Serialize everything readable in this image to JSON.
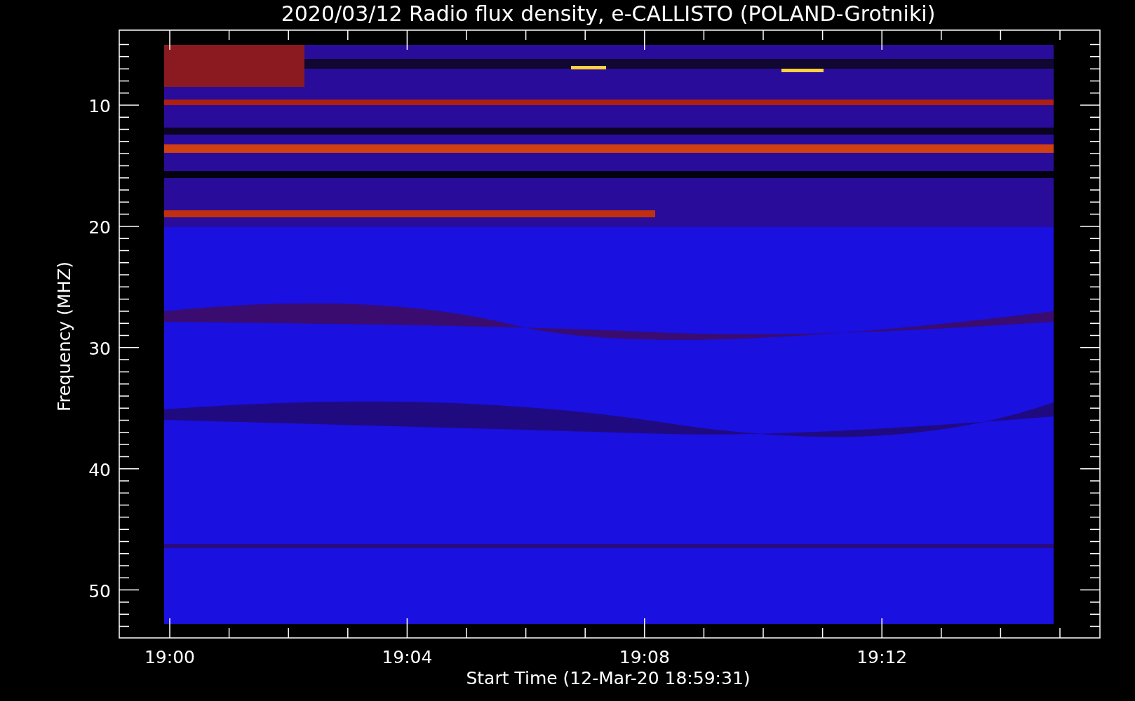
{
  "title": "2020/03/12  Radio flux density, e-CALLISTO (POLAND-Grotniki)",
  "y_axis": {
    "label": "Frequency (MHZ)",
    "ticks": [
      "10",
      "20",
      "30",
      "40",
      "50"
    ]
  },
  "x_axis": {
    "label": "Start Time (12-Mar-20 18:59:31)",
    "ticks": [
      "19:00",
      "19:04",
      "19:08",
      "19:12"
    ]
  }
}
